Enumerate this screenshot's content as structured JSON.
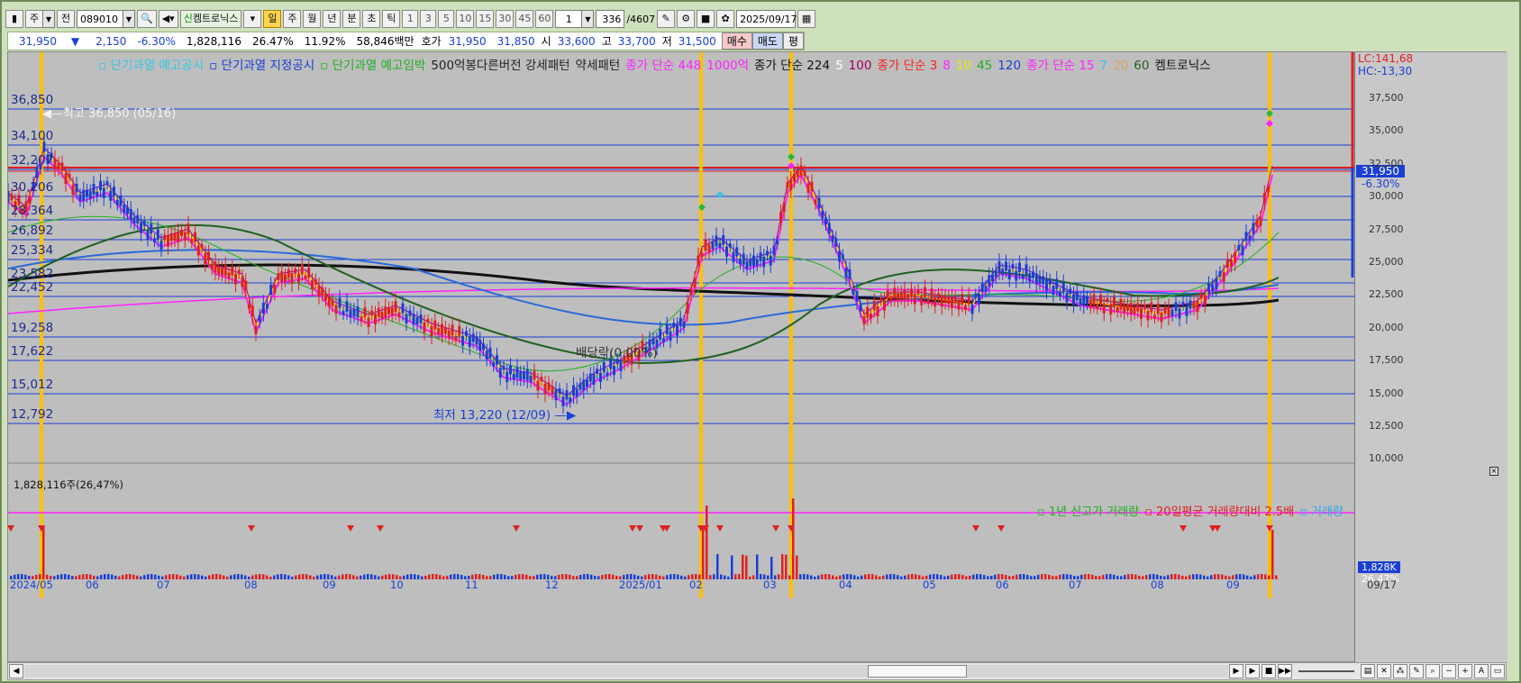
{
  "toolbar": {
    "market": "주",
    "prev": "전",
    "code": "089010",
    "stock_name": "켐트로닉스",
    "periods": [
      "일",
      "주",
      "월",
      "년",
      "분",
      "초",
      "틱"
    ],
    "minute_opts": [
      "1",
      "3",
      "5",
      "10",
      "15",
      "30",
      "45",
      "60"
    ],
    "unit_value": "1",
    "count": "336",
    "total": "/4607",
    "date": "2025/09/17"
  },
  "quote": {
    "price": "31,950",
    "down_arrow": "▼",
    "change": "2,150",
    "change_pct": "-6.30%",
    "volume": "1,828,116",
    "turnover1": "26.47%",
    "turnover2": "11.92%",
    "amount": "58,846백만",
    "hoga_label": "호가",
    "ask": "31,950",
    "bid": "31,850",
    "open_label": "시",
    "open": "33,600",
    "high_label": "고",
    "high": "33,700",
    "low_label": "저",
    "low": "31,500",
    "buy": "매수",
    "sell": "매도",
    "flat": "평"
  },
  "legend": {
    "items": [
      {
        "text": "단기과열 예고공시",
        "color": "#36c6e6"
      },
      {
        "text": "단기과열 지정공시",
        "color": "#1a3fd6"
      },
      {
        "text": "단기과열 예고임박",
        "color": "#20b020"
      },
      {
        "text": "500억봉다른버전 강세패턴",
        "color": "#222222"
      },
      {
        "text": "약세패턴",
        "color": "#222222"
      },
      {
        "text": "종가 단순 448",
        "color": "#ff22ff"
      },
      {
        "text": "1000억",
        "color": "#ff22ff"
      },
      {
        "text": "종가 단순 224",
        "color": "#111111"
      },
      {
        "text": "5",
        "color": "#ffffff"
      },
      {
        "text": "100",
        "color": "#a00060"
      },
      {
        "text": "종가 단순 3",
        "color": "#ff2020"
      },
      {
        "text": "8",
        "color": "#ff22ff"
      },
      {
        "text": "10",
        "color": "#e8e800"
      },
      {
        "text": "45",
        "color": "#20b020"
      },
      {
        "text": "120",
        "color": "#1a3fd6"
      },
      {
        "text": "종가 단순 15",
        "color": "#ff22ff"
      },
      {
        "text": "7",
        "color": "#36c6e6"
      },
      {
        "text": "20",
        "color": "#e0a060"
      },
      {
        "text": "60",
        "color": "#206020"
      },
      {
        "text": "켐트로닉스",
        "color": "#111111"
      }
    ]
  },
  "right_labels": {
    "lc": "LC:141,68",
    "hc": "HC:-13,30",
    "last_price": "31,950",
    "last_pct": "-6.30%",
    "vol_last": "1,828K",
    "vol_pct": "26.47%"
  },
  "levels": [
    "36,850",
    "34,100",
    "32,207",
    "30,206",
    "28,364",
    "26,892",
    "25,334",
    "23,582",
    "22,452",
    "19,258",
    "17,622",
    "15,012",
    "12,792"
  ],
  "price_axis": [
    "37,500",
    "35,000",
    "32,500",
    "30,000",
    "27,500",
    "25,000",
    "22,500",
    "20,000",
    "17,500",
    "15,000",
    "12,500",
    "10,000"
  ],
  "annotations": {
    "high": "최고 36,850 (05/16)",
    "low": "최저 13,220 (12/09)",
    "dividend": "배당락(0.00%)",
    "vol_top": "1,828,116주(26,47%)"
  },
  "vol_legend": [
    {
      "text": "1년 신고가 거래량",
      "color": "#20b020"
    },
    {
      "text": "20일평균 거래량대비 2.5배",
      "color": "#e02020"
    },
    {
      "text": "거래량",
      "color": "#36a6e6"
    }
  ],
  "x_axis": [
    "2024/05",
    "06",
    "07",
    "08",
    "09",
    "10",
    "11",
    "12",
    "2025/01",
    "02",
    "03",
    "04",
    "05",
    "06",
    "07",
    "08",
    "09",
    "09/17"
  ]
}
